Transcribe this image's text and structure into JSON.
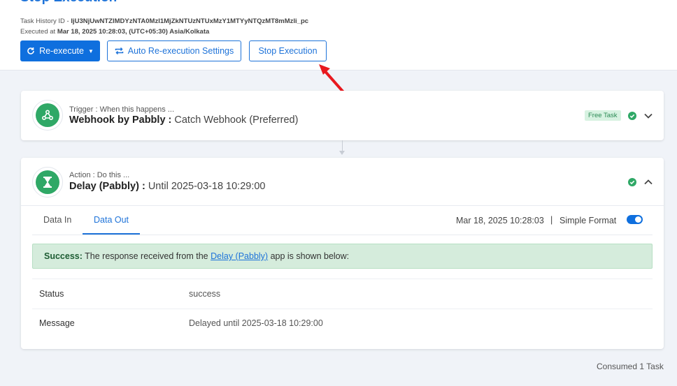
{
  "header": {
    "title": "Stop Execution",
    "task_history_label": "Task History ID - ",
    "task_history_id": "IjU3NjUwNTZlMDYzNTA0MzI1MjZkNTUzNTUxMzY1MTYyNTQzMT8mMzli_pc",
    "executed_label": "Executed at ",
    "executed_at": "Mar 18, 2025 10:28:03, (UTC+05:30) Asia/Kolkata"
  },
  "toolbar": {
    "reexecute_label": "Re-execute",
    "auto_settings_label": "Auto Re-execution Settings",
    "stop_label": "Stop Execution"
  },
  "trigger": {
    "subtitle": "Trigger : When this happens ...",
    "app": "Webhook by Pabbly :",
    "event": "Catch Webhook (Preferred)",
    "badge": "Free Task"
  },
  "action": {
    "subtitle": "Action : Do this ...",
    "app": "Delay (Pabbly) :",
    "event": "Until 2025-03-18 10:29:00",
    "tabs": [
      "Data In",
      "Data Out"
    ],
    "active_tab": "Data Out",
    "exec_time": "Mar 18, 2025 10:28:03",
    "separator": "|",
    "format_label": "Simple Format",
    "simple_format_on": true,
    "alert": {
      "strong": "Success:",
      "pre": " The response received from the ",
      "link": "Delay (Pabbly)",
      "post": " app is shown below:"
    },
    "rows": [
      {
        "label": "Status",
        "value": "success"
      },
      {
        "label": "Message",
        "value": "Delayed until 2025-03-18 10:29:00"
      }
    ]
  },
  "footer": {
    "consumed": "Consumed 1 Task"
  },
  "colors": {
    "accent": "#1e73d9",
    "success": "#2fa866",
    "annotation_arrow": "#e8191f"
  },
  "icons": [
    "refresh-icon",
    "repeat-icon",
    "webhook-icon",
    "hourglass-icon",
    "check-circle-icon",
    "chevron-down-icon",
    "chevron-up-icon",
    "red-arrow-annotation"
  ]
}
